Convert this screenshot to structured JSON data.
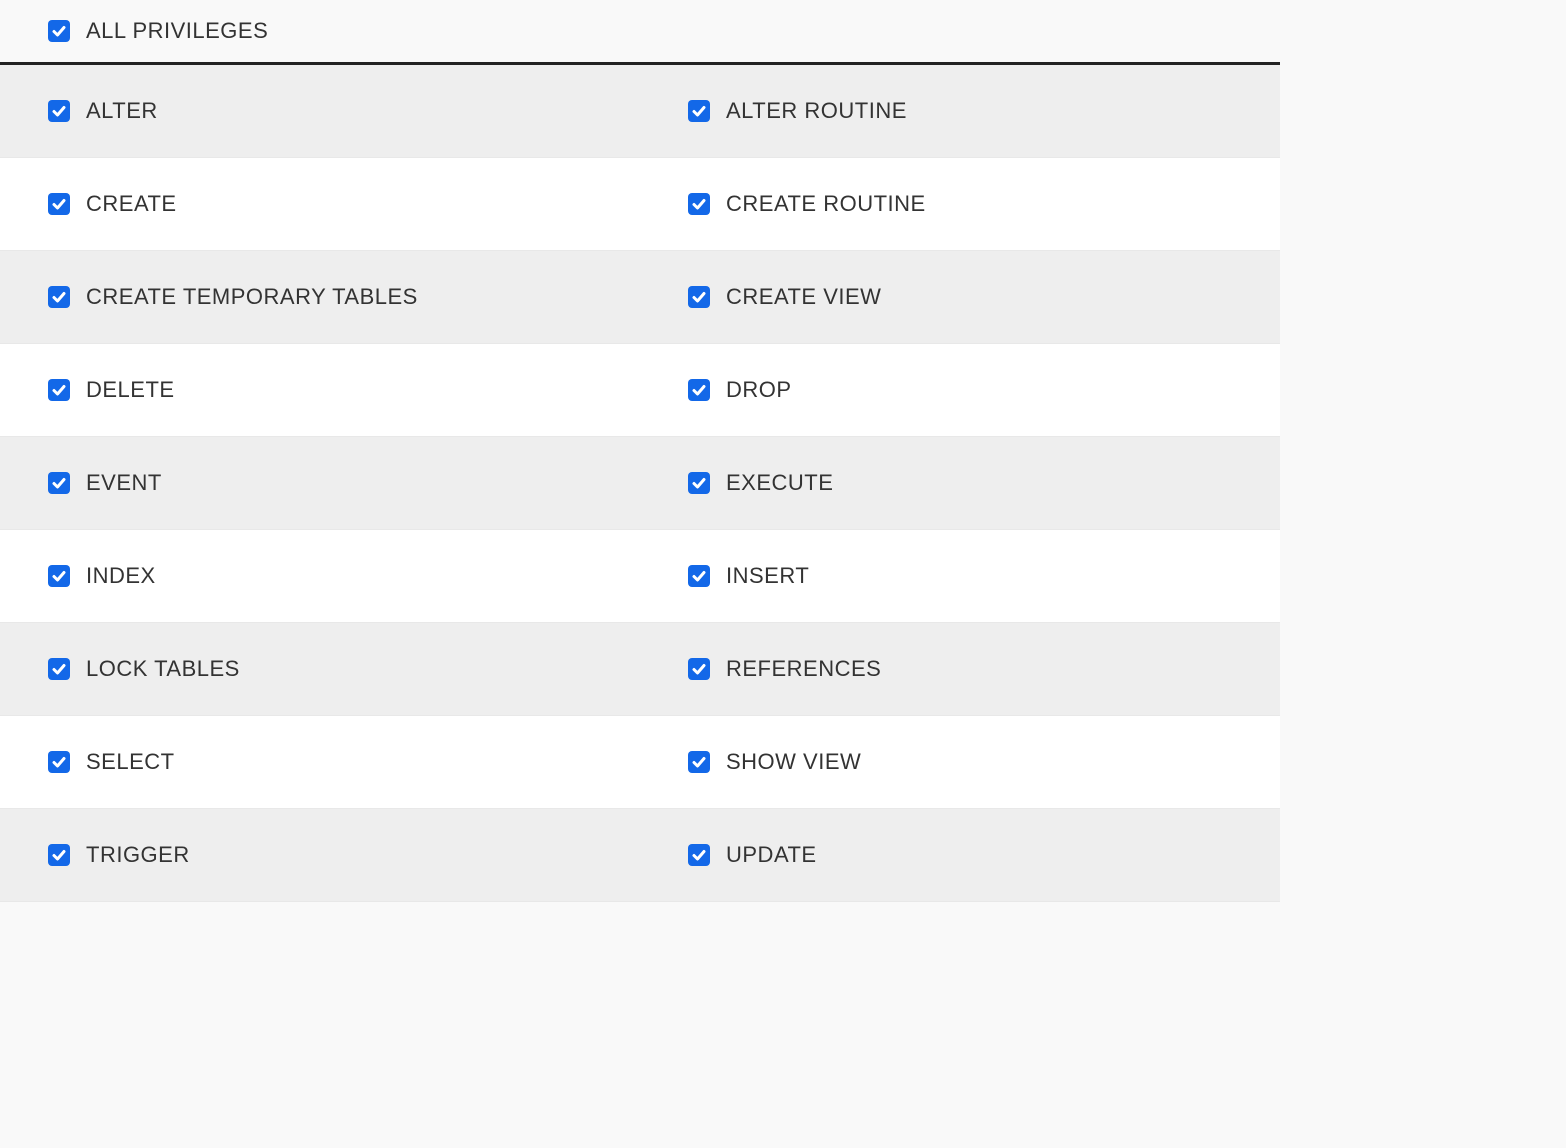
{
  "all_privileges": {
    "label": "ALL PRIVILEGES",
    "checked": true
  },
  "rows": [
    {
      "left": {
        "label": "ALTER",
        "checked": true
      },
      "right": {
        "label": "ALTER ROUTINE",
        "checked": true
      }
    },
    {
      "left": {
        "label": "CREATE",
        "checked": true
      },
      "right": {
        "label": "CREATE ROUTINE",
        "checked": true
      }
    },
    {
      "left": {
        "label": "CREATE TEMPORARY TABLES",
        "checked": true
      },
      "right": {
        "label": "CREATE VIEW",
        "checked": true
      }
    },
    {
      "left": {
        "label": "DELETE",
        "checked": true
      },
      "right": {
        "label": "DROP",
        "checked": true
      }
    },
    {
      "left": {
        "label": "EVENT",
        "checked": true
      },
      "right": {
        "label": "EXECUTE",
        "checked": true
      }
    },
    {
      "left": {
        "label": "INDEX",
        "checked": true
      },
      "right": {
        "label": "INSERT",
        "checked": true
      }
    },
    {
      "left": {
        "label": "LOCK TABLES",
        "checked": true
      },
      "right": {
        "label": "REFERENCES",
        "checked": true
      }
    },
    {
      "left": {
        "label": "SELECT",
        "checked": true
      },
      "right": {
        "label": "SHOW VIEW",
        "checked": true
      }
    },
    {
      "left": {
        "label": "TRIGGER",
        "checked": true
      },
      "right": {
        "label": "UPDATE",
        "checked": true
      }
    }
  ]
}
